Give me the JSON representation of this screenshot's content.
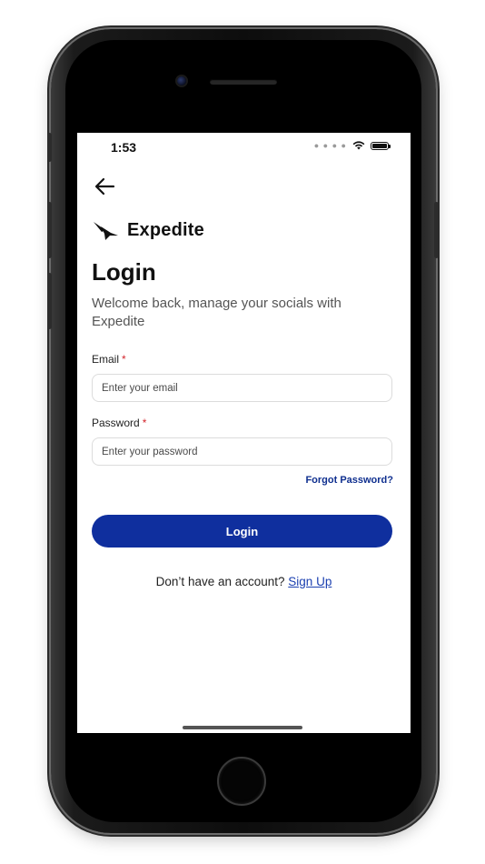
{
  "status_bar": {
    "time": "1:53",
    "signal_icon": "cellular-dots-icon",
    "wifi_icon": "wifi-icon",
    "battery_icon": "battery-icon"
  },
  "nav": {
    "back_icon": "arrow-left-icon"
  },
  "brand": {
    "logo_icon": "bird-logo-icon",
    "name": "Expedite"
  },
  "login": {
    "title": "Login",
    "subtitle": "Welcome back, manage your socials with Expedite",
    "email": {
      "label": "Email",
      "required_mark": "*",
      "placeholder": "Enter your email",
      "value": ""
    },
    "password": {
      "label": "Password",
      "required_mark": "*",
      "placeholder": "Enter your password",
      "value": ""
    },
    "forgot_password": "Forgot Password?",
    "submit_label": "Login",
    "signup_prompt": "Don’t have an account?",
    "signup_link": "Sign Up"
  },
  "colors": {
    "primary": "#0f2f9e",
    "link": "#1a3fb0",
    "required": "#d3262d"
  }
}
